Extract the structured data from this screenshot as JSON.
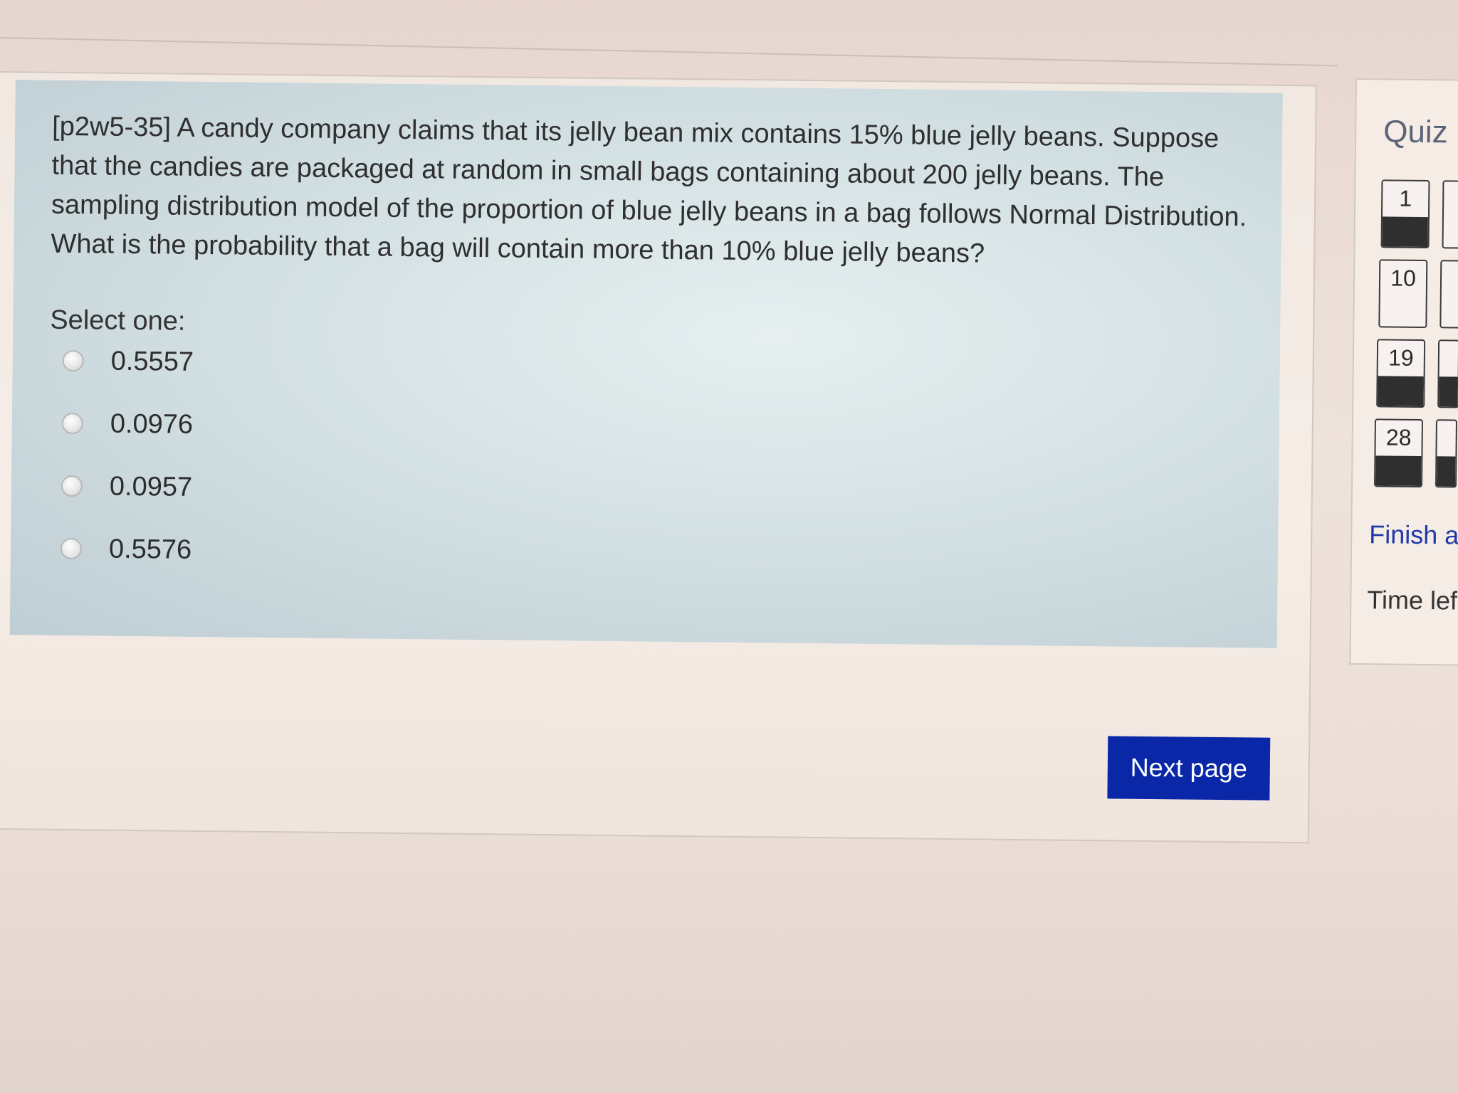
{
  "question": {
    "text": "[p2w5-35] A candy company claims that its jelly bean mix contains 15% blue jelly beans. Suppose that the candies are packaged at random in small bags containing about 200 jelly beans. The sampling distribution model of the proportion of blue jelly beans in a bag follows Normal Distribution. What is the probability that a bag will contain more than 10% blue jelly beans?",
    "select_label": "Select one:",
    "options": [
      {
        "label": "0.5557"
      },
      {
        "label": "0.0976"
      },
      {
        "label": "0.0957"
      },
      {
        "label": "0.5576"
      }
    ]
  },
  "actions": {
    "next_label": "Next page"
  },
  "quiz_nav": {
    "title": "Quiz n",
    "buttons": [
      {
        "number": "1",
        "answered": true
      },
      {
        "number": "10",
        "answered": false
      },
      {
        "number": "19",
        "answered": true
      },
      {
        "number": "28",
        "answered": true
      }
    ],
    "finish_label": "Finish a",
    "time_left_label": "Time lef"
  },
  "colors": {
    "question_bg": "#d4e1e4",
    "primary_button": "#0a27a8",
    "link": "#1f3aa8"
  }
}
